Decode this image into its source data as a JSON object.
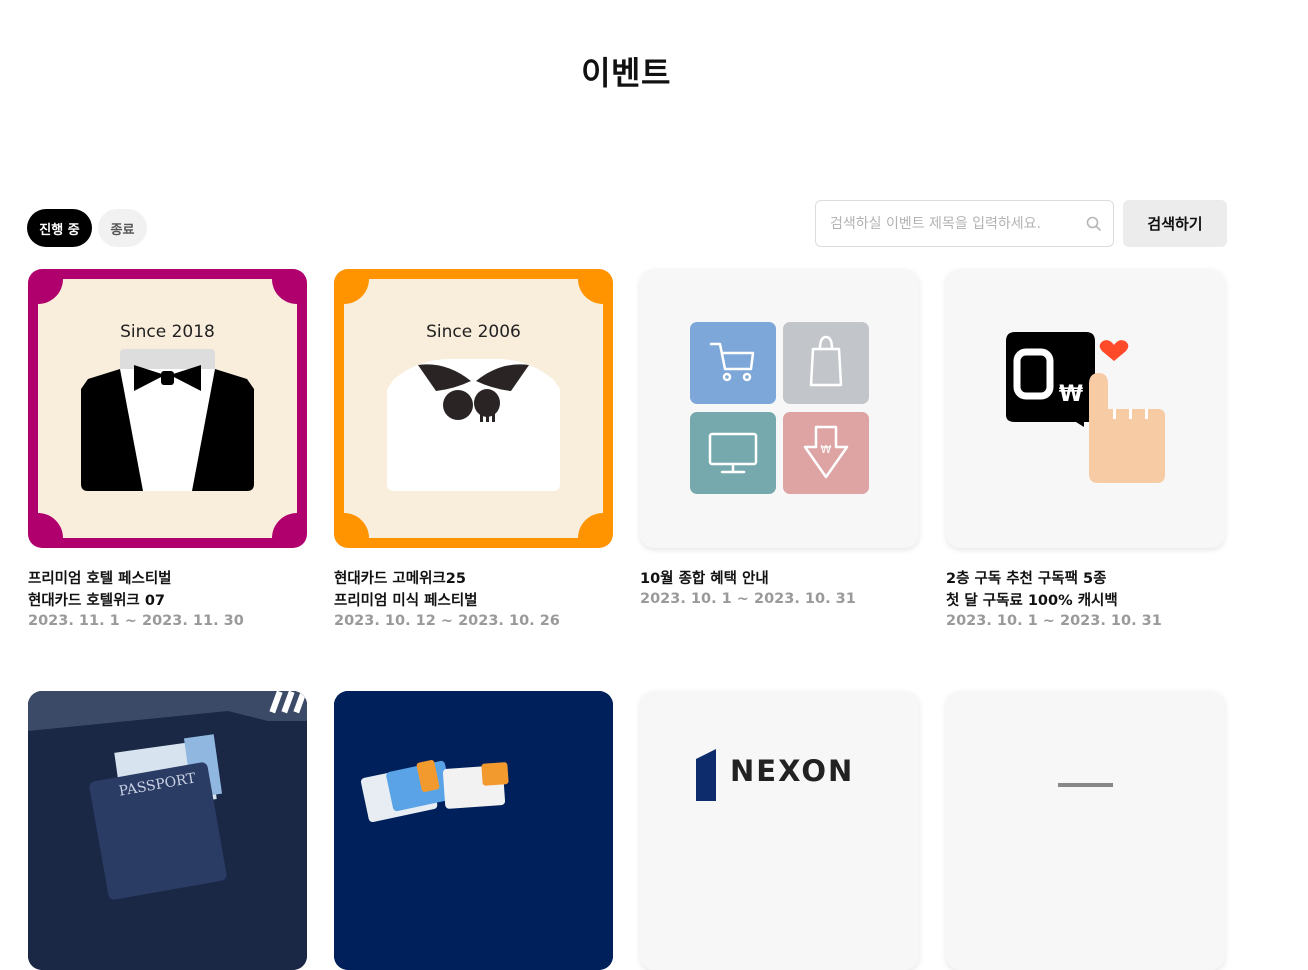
{
  "page": {
    "title": "이벤트"
  },
  "filters": [
    {
      "label": "진행 중",
      "active": true
    },
    {
      "label": "종료",
      "active": false
    }
  ],
  "search": {
    "placeholder": "검색하실 이벤트 제목을 입력하세요.",
    "value": "",
    "button_label": "검색하기"
  },
  "events": [
    {
      "title_line1": "프리미엄 호텔 페스티벌",
      "title_line2": "현대카드 호텔위크 07",
      "period": "2023. 11. 1 ~ 2023. 11. 30",
      "image_text": "Since 2018",
      "frame_color": "#b0006e"
    },
    {
      "title_line1": "현대카드 고메위크25",
      "title_line2": "프리미엄 미식 페스티벌",
      "period": "2023. 10. 12 ~ 2023. 10. 26",
      "image_text": "Since 2006",
      "frame_color": "#ff9300"
    },
    {
      "title_line1": "10월 종합 혜택 안내",
      "title_line2": "",
      "period": "2023. 10. 1 ~ 2023. 10. 31",
      "image_text": ""
    },
    {
      "title_line1": "2층 구독 추천 구독팩 5종",
      "title_line2": "첫 달 구독료 100% 캐시백",
      "period": "2023. 10. 1 ~ 2023. 10. 31",
      "image_text": ""
    }
  ],
  "second_row": [
    {
      "image_text": "PASSPORT"
    },
    {
      "image_text": ""
    },
    {
      "image_text": "NEXON"
    },
    {
      "image_text": ""
    }
  ],
  "colors": {
    "active_pill": "#000000",
    "inactive_pill": "#f1f1f1",
    "period_text": "#9a9a9a",
    "hotel_frame": "#b0006e",
    "gourmet_frame": "#ff9300",
    "cream": "#f9eddc"
  }
}
